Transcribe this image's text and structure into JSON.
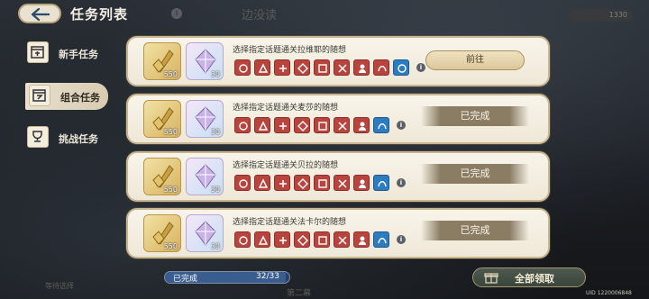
{
  "header": {
    "title": "任务列表"
  },
  "sidebar": {
    "tabs": [
      {
        "label": "新手任务",
        "active": false
      },
      {
        "label": "组合任务",
        "active": true
      },
      {
        "label": "挑战任务",
        "active": false
      }
    ]
  },
  "background": {
    "title": "边没读",
    "counter": "1330",
    "chapter": "第二幕",
    "select": "等待选择"
  },
  "tasks": [
    {
      "title": "选择指定话题通关拉维耶的随想",
      "rewards": [
        {
          "icon": "gold-coin-icon",
          "qty": "550"
        },
        {
          "icon": "prism-crystal-icon",
          "qty": "30"
        }
      ],
      "sub_icon_colors": [
        "red",
        "red",
        "red",
        "red",
        "red",
        "red",
        "red",
        "red",
        "blue"
      ],
      "status": "前往",
      "completed": false
    },
    {
      "title": "选择指定话题通关麦莎的随想",
      "rewards": [
        {
          "icon": "gold-coin-icon",
          "qty": "550"
        },
        {
          "icon": "prism-crystal-icon",
          "qty": "30"
        }
      ],
      "sub_icon_colors": [
        "red",
        "red",
        "red",
        "red",
        "red",
        "red",
        "red",
        "blue"
      ],
      "status": "已完成",
      "completed": true
    },
    {
      "title": "选择指定话题通关贝拉的随想",
      "rewards": [
        {
          "icon": "gold-coin-icon",
          "qty": "550"
        },
        {
          "icon": "prism-crystal-icon",
          "qty": "30"
        }
      ],
      "sub_icon_colors": [
        "red",
        "red",
        "red",
        "red",
        "red",
        "red",
        "red",
        "blue"
      ],
      "status": "已完成",
      "completed": true
    },
    {
      "title": "选择指定话题通关法卡尔的随想",
      "rewards": [
        {
          "icon": "gold-coin-icon",
          "qty": "550"
        },
        {
          "icon": "prism-crystal-icon",
          "qty": "30"
        }
      ],
      "sub_icon_colors": [
        "red",
        "red",
        "red",
        "red",
        "red",
        "red",
        "red",
        "blue"
      ],
      "status": "已完成",
      "completed": true
    }
  ],
  "progress": {
    "label": "已完成",
    "count": "32/33",
    "fraction": 0.97
  },
  "claim_all": {
    "label": "全部领取"
  },
  "uid": "UID 1220006848",
  "colors": {
    "card_bg": "#f6f1e4",
    "red_icon": "#b8443e",
    "blue_icon": "#2e7cc0",
    "done_banner": "#78694e"
  }
}
